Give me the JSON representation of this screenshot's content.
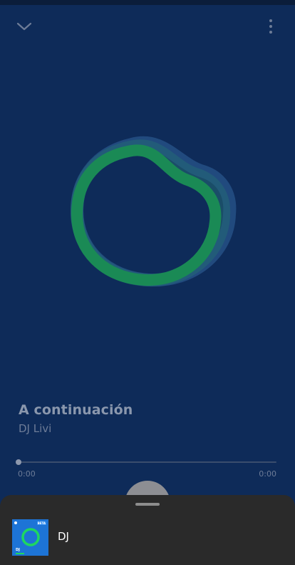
{
  "player": {
    "track_title": "A continuación",
    "track_artist": "DJ Livi",
    "progress_fraction": 0.0,
    "elapsed": "0:00",
    "total": "0:00"
  },
  "icons": {
    "collapse": "chevron-down-icon",
    "more": "more-vertical-icon",
    "artwork": "dj-blob-artwork"
  },
  "queue": {
    "items": [
      {
        "title": "DJ",
        "thumb_badge": "BETA",
        "thumb_label": "DJ"
      }
    ]
  },
  "colors": {
    "background": "#0e2b59",
    "accent_green": "#1db954",
    "sheet": "#2a2a2a"
  }
}
